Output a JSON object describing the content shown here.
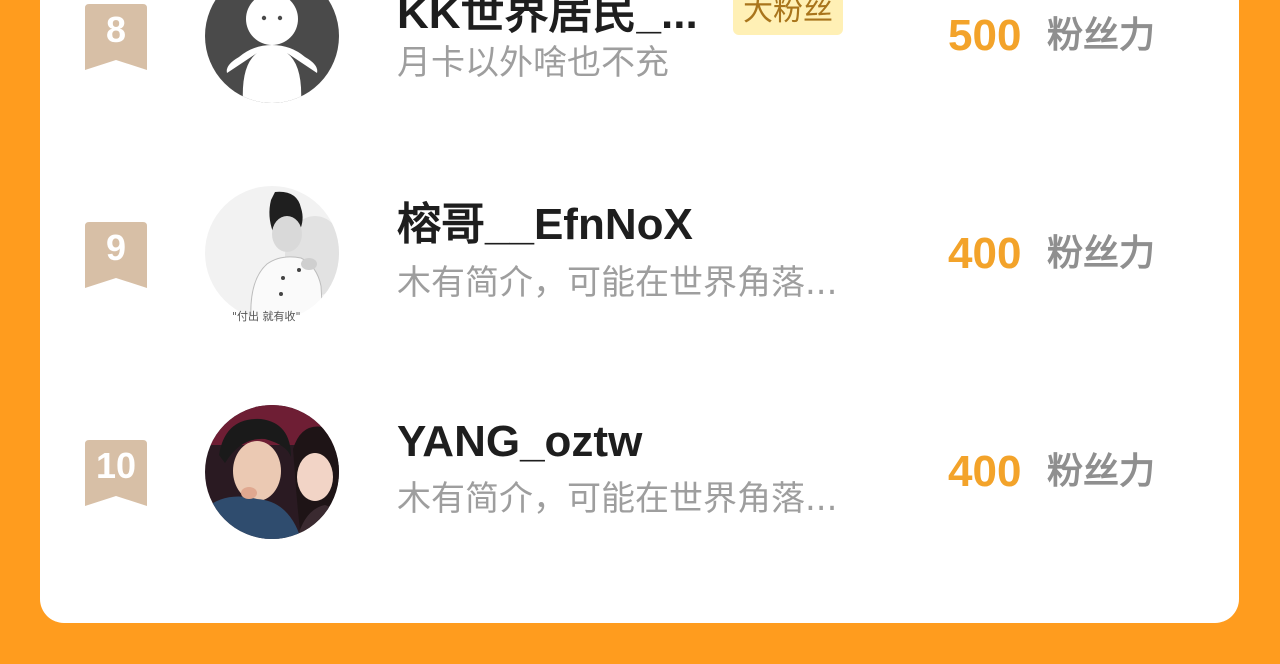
{
  "colors": {
    "page_background": "#FF9C1E",
    "card_background": "#FFFFFF",
    "rank_badge": "#D7BFA6",
    "points": "#F3A32A",
    "name": "#1E1E1E",
    "bio": "#9E9E9E",
    "tag_background": "#FFF0B5",
    "tag_text": "#A9751C"
  },
  "leaderboard": {
    "rows": [
      {
        "rank": "8",
        "name": "KK世界居民_...",
        "tag": "大粉丝",
        "bio": "月卡以外啥也不充",
        "points": "500",
        "points_unit": "粉丝力",
        "avatar": "default-silhouette-avatar"
      },
      {
        "rank": "9",
        "name": "榕哥__EfnNoX",
        "bio": "木有简介，可能在世界角落...",
        "points": "400",
        "points_unit": "粉丝力",
        "avatar": "photo-avatar-boy",
        "avatar_caption": "\"付出 就有收\""
      },
      {
        "rank": "10",
        "name": "YANG_oztw",
        "bio": "木有简介，可能在世界角落...",
        "points": "400",
        "points_unit": "粉丝力",
        "avatar": "photo-avatar-couple"
      }
    ]
  }
}
